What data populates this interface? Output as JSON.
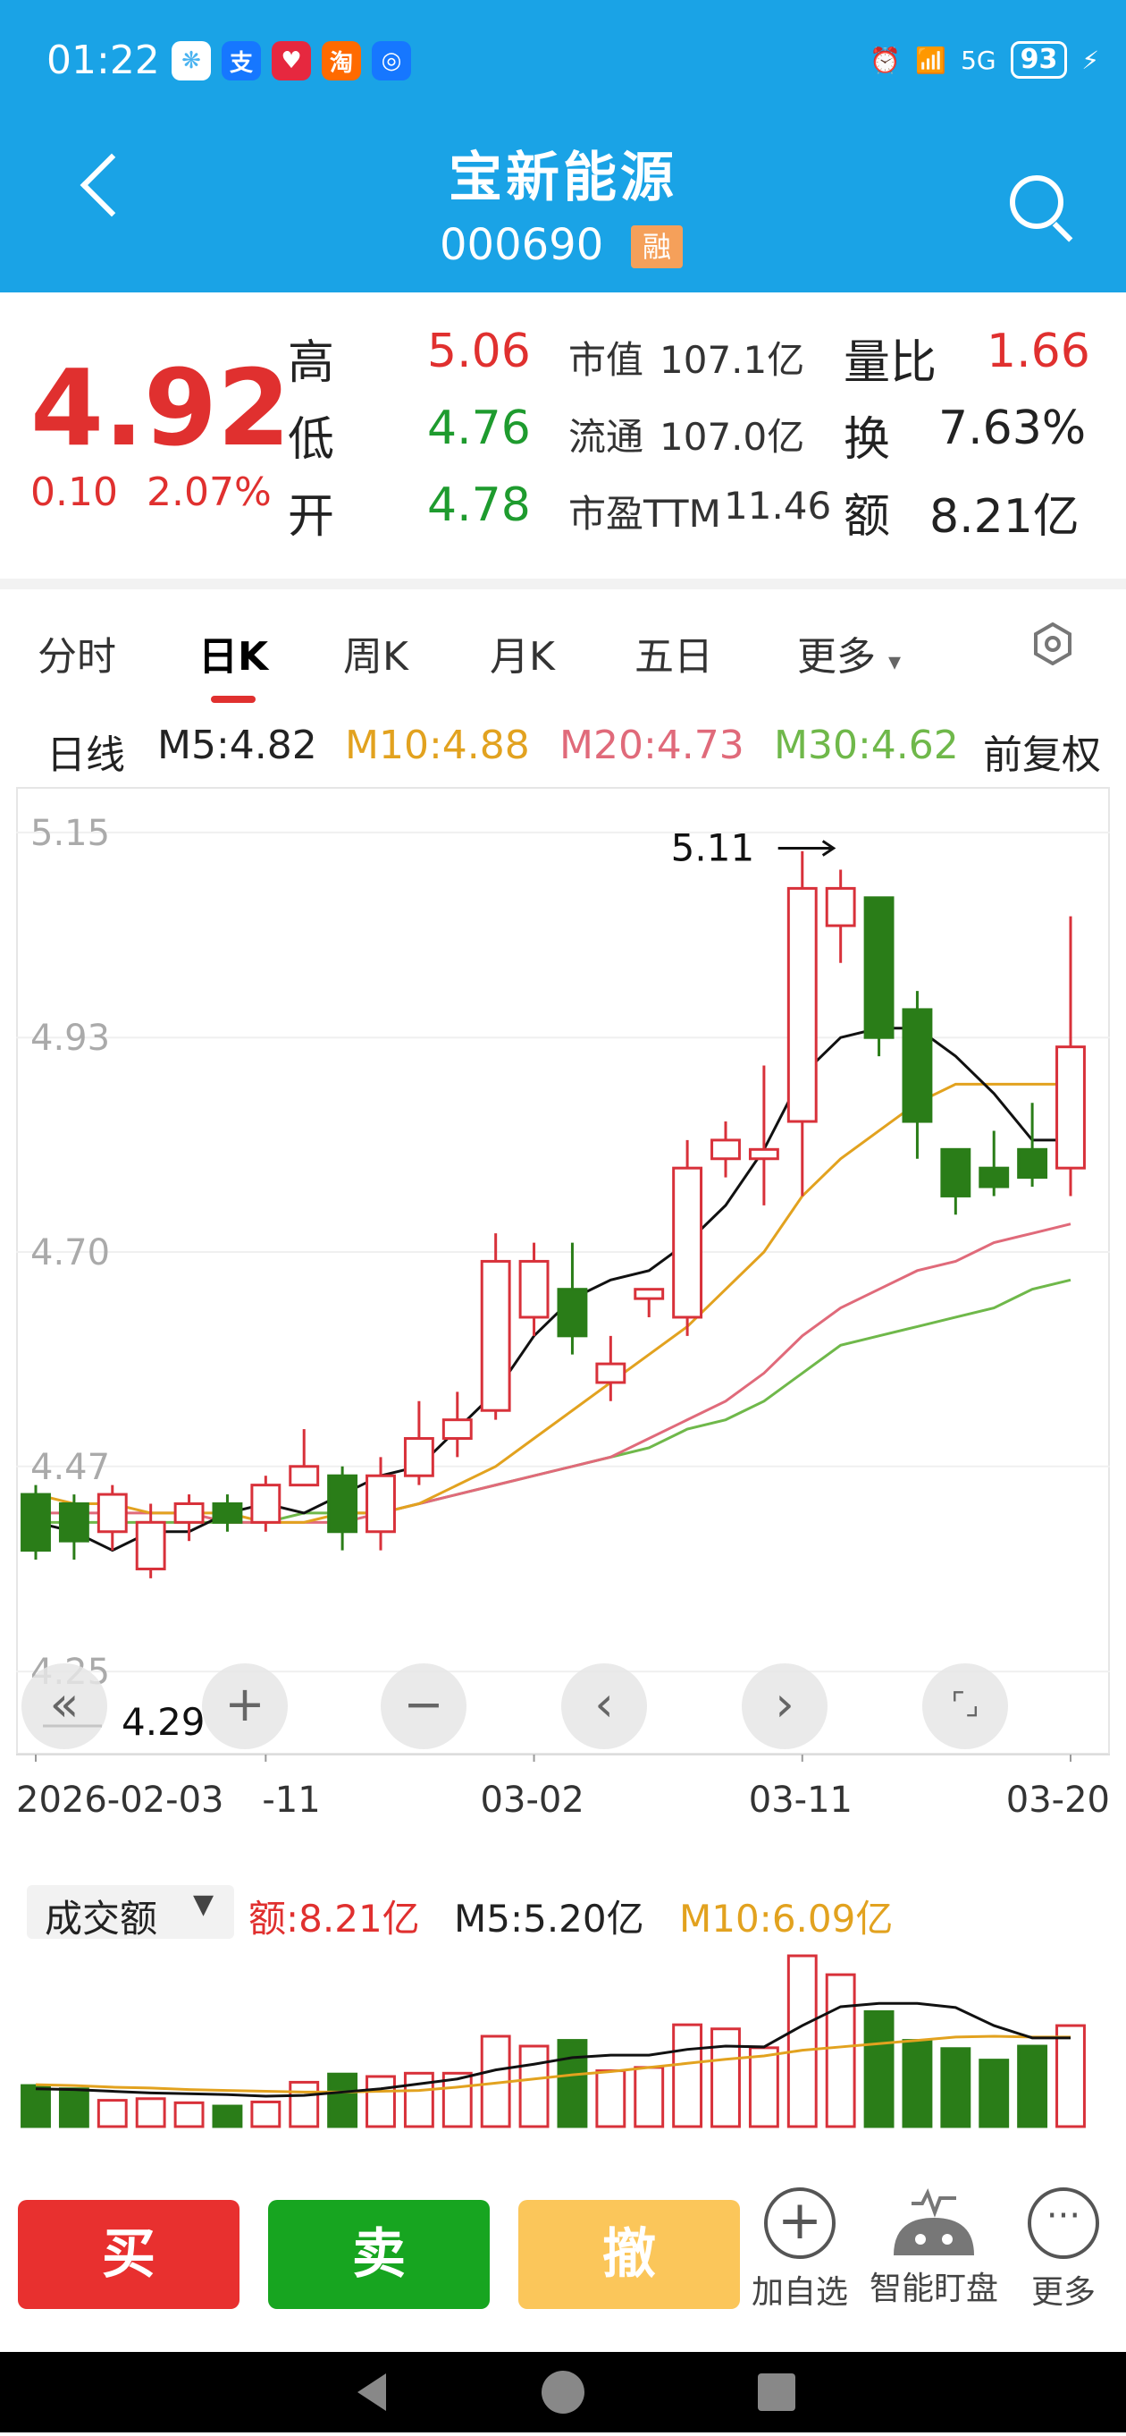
{
  "status_bar": {
    "time": "01:22",
    "apps": [
      "支",
      "淘"
    ],
    "signal": "5G",
    "battery": "93"
  },
  "header": {
    "title": "宝新能源",
    "code": "000690",
    "badge": "融"
  },
  "quote": {
    "price": "4.92",
    "change": "0.10",
    "change_pct": "2.07%",
    "rows": [
      {
        "l1": "高",
        "v1": "5.06",
        "l2": "市值",
        "v2": "107.1亿",
        "l3": "量比",
        "v3": "1.66"
      },
      {
        "l1": "低",
        "v1": "4.76",
        "l2": "流通",
        "v2": "107.0亿",
        "l3": "换",
        "v3": "7.63%"
      },
      {
        "l1": "开",
        "v1": "4.78",
        "l2": "市盈TTM",
        "v2": "11.46",
        "l3": "额",
        "v3": "8.21亿"
      }
    ]
  },
  "tabs": [
    "分时",
    "日K",
    "周K",
    "月K",
    "五日",
    "更多"
  ],
  "ma_line": {
    "label": "日线",
    "m5": "M5:4.82",
    "m10": "M10:4.88",
    "m20": "M20:4.73",
    "m30": "M30:4.62",
    "adjust": "前复权"
  },
  "colors": {
    "up": "#d8313a",
    "down": "#2a7d18",
    "ma5": "#111111",
    "ma10": "#e2a21f",
    "ma20": "#e06a7a",
    "ma30": "#6fb84a"
  },
  "chart_data": {
    "type": "candlestick",
    "yticks": [
      "5.15",
      "4.93",
      "4.70",
      "4.47",
      "4.25"
    ],
    "ylim": [
      4.23,
      5.17
    ],
    "xticks": [
      "2026-02-03",
      "-11",
      "03-02",
      "03-11",
      "03-20"
    ],
    "annotations": {
      "high": "5.11",
      "low": "4.29"
    },
    "candles": [
      [
        4.44,
        4.38,
        4.45,
        4.37
      ],
      [
        4.43,
        4.39,
        4.44,
        4.37
      ],
      [
        4.4,
        4.44,
        4.45,
        4.38
      ],
      [
        4.36,
        4.41,
        4.43,
        4.35
      ],
      [
        4.41,
        4.43,
        4.44,
        4.39
      ],
      [
        4.43,
        4.41,
        4.44,
        4.4
      ],
      [
        4.41,
        4.45,
        4.46,
        4.4
      ],
      [
        4.45,
        4.47,
        4.51,
        4.45
      ],
      [
        4.46,
        4.4,
        4.47,
        4.38
      ],
      [
        4.4,
        4.46,
        4.48,
        4.38
      ],
      [
        4.46,
        4.5,
        4.54,
        4.45
      ],
      [
        4.5,
        4.52,
        4.55,
        4.48
      ],
      [
        4.53,
        4.69,
        4.72,
        4.52
      ],
      [
        4.63,
        4.69,
        4.71,
        4.61
      ],
      [
        4.66,
        4.61,
        4.71,
        4.59
      ],
      [
        4.56,
        4.58,
        4.61,
        4.54
      ],
      [
        4.65,
        4.66,
        4.66,
        4.63
      ],
      [
        4.63,
        4.79,
        4.82,
        4.61
      ],
      [
        4.8,
        4.82,
        4.84,
        4.78
      ],
      [
        4.8,
        4.81,
        4.9,
        4.75
      ],
      [
        4.84,
        5.09,
        5.13,
        4.76
      ],
      [
        5.05,
        5.09,
        5.11,
        5.01
      ],
      [
        5.08,
        4.93,
        5.08,
        4.91
      ],
      [
        4.96,
        4.84,
        4.98,
        4.8
      ],
      [
        4.81,
        4.76,
        4.81,
        4.74
      ],
      [
        4.79,
        4.77,
        4.83,
        4.76
      ],
      [
        4.81,
        4.78,
        4.86,
        4.77
      ],
      [
        4.79,
        4.92,
        5.06,
        4.76
      ]
    ],
    "ma5": [
      4.41,
      4.4,
      4.38,
      4.4,
      4.4,
      4.42,
      4.43,
      4.42,
      4.44,
      4.46,
      4.47,
      4.51,
      4.55,
      4.61,
      4.65,
      4.67,
      4.68,
      4.71,
      4.75,
      4.81,
      4.89,
      4.93,
      4.94,
      4.94,
      4.91,
      4.87,
      4.82,
      4.82
    ],
    "ma10": [
      4.44,
      4.43,
      4.43,
      4.42,
      4.42,
      4.42,
      4.41,
      4.41,
      4.42,
      4.42,
      4.43,
      4.45,
      4.47,
      4.5,
      4.53,
      4.56,
      4.59,
      4.62,
      4.66,
      4.7,
      4.76,
      4.8,
      4.83,
      4.86,
      4.88,
      4.88,
      4.88,
      4.88
    ],
    "ma20": [
      4.42,
      4.42,
      4.42,
      4.42,
      4.42,
      4.41,
      4.41,
      4.41,
      4.41,
      4.42,
      4.43,
      4.44,
      4.45,
      4.46,
      4.47,
      4.48,
      4.5,
      4.52,
      4.54,
      4.57,
      4.61,
      4.64,
      4.66,
      4.68,
      4.69,
      4.71,
      4.72,
      4.73
    ],
    "ma30": [
      4.41,
      4.41,
      4.41,
      4.41,
      4.41,
      4.41,
      4.41,
      4.42,
      4.42,
      4.42,
      4.43,
      4.44,
      4.45,
      4.46,
      4.47,
      4.48,
      4.49,
      4.51,
      4.52,
      4.54,
      4.57,
      4.6,
      4.61,
      4.62,
      4.63,
      4.64,
      4.66,
      4.67
    ],
    "volume": [
      5.0,
      4.6,
      3.2,
      3.4,
      2.9,
      2.5,
      3.0,
      5.4,
      6.4,
      6.1,
      6.5,
      6.5,
      11.0,
      9.8,
      10.5,
      6.8,
      7.2,
      12.4,
      11.9,
      9.6,
      20.8,
      18.5,
      14.0,
      10.5,
      9.5,
      8.1,
      9.8,
      12.3
    ],
    "vol_ma5": [
      4.6,
      4.5,
      4.3,
      4.1,
      4.0,
      3.9,
      3.7,
      3.8,
      4.2,
      4.6,
      5.2,
      5.8,
      6.9,
      7.6,
      8.4,
      8.7,
      8.7,
      9.4,
      9.8,
      9.7,
      12.3,
      14.6,
      15.0,
      15.0,
      14.5,
      12.3,
      10.8,
      10.8
    ],
    "vol_ma10": [
      5.1,
      5.0,
      4.8,
      4.7,
      4.5,
      4.4,
      4.3,
      4.2,
      4.2,
      4.3,
      4.4,
      4.8,
      5.3,
      5.8,
      6.3,
      6.7,
      7.2,
      7.7,
      8.2,
      8.6,
      9.3,
      9.7,
      10.1,
      10.5,
      10.9,
      11.0,
      10.9,
      10.9
    ]
  },
  "volume_panel": {
    "label": "成交额",
    "amount": "额:8.21亿",
    "m5": "M5:5.20亿",
    "m10": "M10:6.09亿"
  },
  "zoom_controls": [
    "«",
    "+",
    "−",
    "‹",
    "›",
    "⌜⌟"
  ],
  "actions": {
    "buy": "买",
    "sell": "卖",
    "cancel": "撤",
    "add": "加自选",
    "smart": "智能盯盘",
    "more": "更多"
  }
}
